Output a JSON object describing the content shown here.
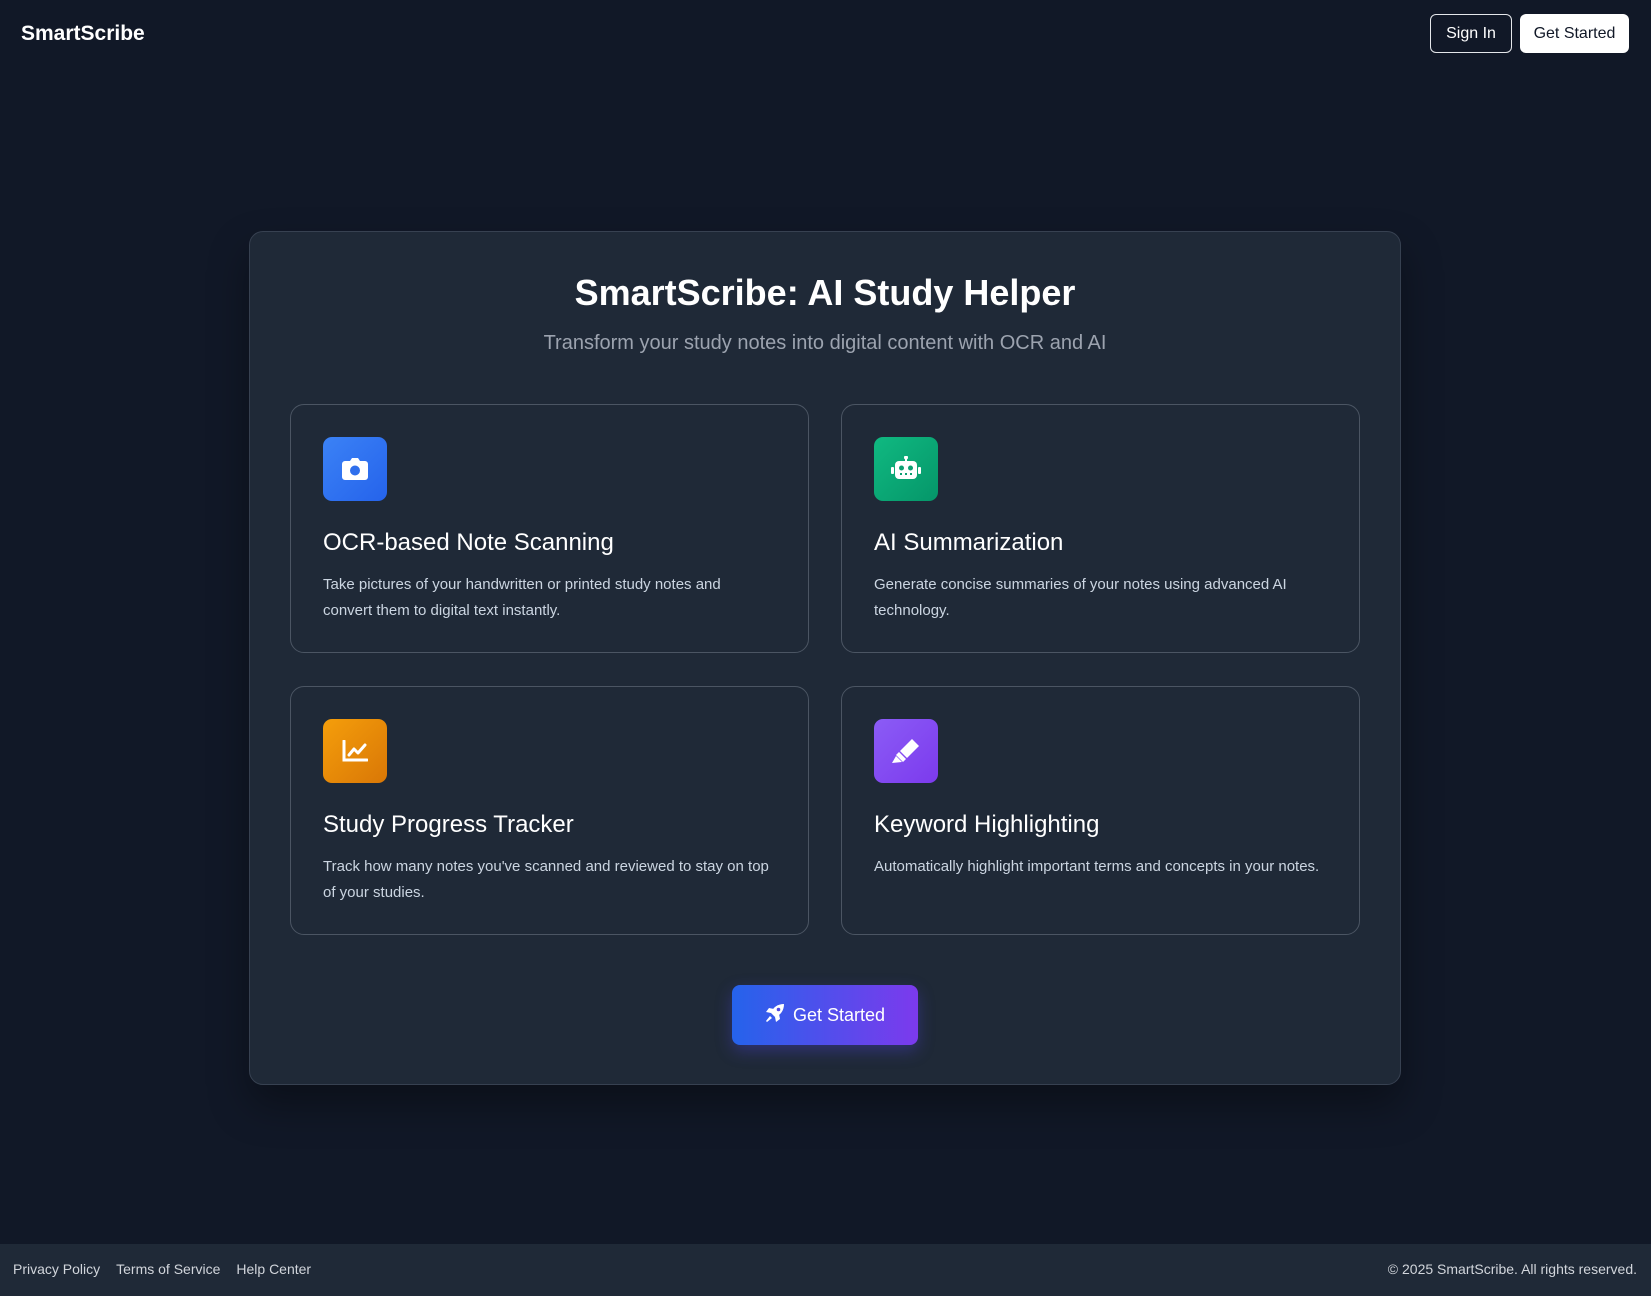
{
  "header": {
    "brand": "SmartScribe",
    "sign_in_label": "Sign In",
    "get_started_label": "Get Started"
  },
  "hero": {
    "title": "SmartScribe: AI Study Helper",
    "subtitle": "Transform your study notes into digital content with OCR and AI"
  },
  "features": [
    {
      "icon": "camera-icon",
      "color": "#3b82f6",
      "title": "OCR-based Note Scanning",
      "description": "Take pictures of your handwritten or printed study notes and convert them to digital text instantly."
    },
    {
      "icon": "robot-icon",
      "color": "#10b981",
      "title": "AI Summarization",
      "description": "Generate concise summaries of your notes using advanced AI technology."
    },
    {
      "icon": "chart-line-icon",
      "color": "#f59e0b",
      "title": "Study Progress Tracker",
      "description": "Track how many notes you've scanned and reviewed to stay on top of your studies."
    },
    {
      "icon": "highlighter-icon",
      "color": "#8b5cf6",
      "title": "Keyword Highlighting",
      "description": "Automatically highlight important terms and concepts in your notes."
    }
  ],
  "cta": {
    "icon": "rocket-icon",
    "label": "Get Started"
  },
  "footer": {
    "links": [
      "Privacy Policy",
      "Terms of Service",
      "Help Center"
    ],
    "copyright": "© 2025 SmartScribe. All rights reserved."
  }
}
